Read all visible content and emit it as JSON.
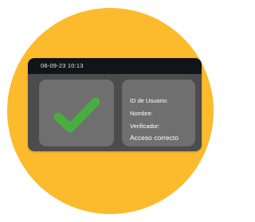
{
  "device": {
    "datetime": "08-09-23  10:13",
    "result_icon": "checkmark-icon",
    "info": {
      "user_id_label": "ID de Usuario:",
      "name_label": "Nombre:",
      "verifier_label": "Verificador:",
      "status": "Acceso correcto"
    }
  },
  "colors": {
    "backdrop": "#fcbb2c",
    "device_body": "#4b4c4b",
    "status_bar": "#111418",
    "panel": "#6e6f6e",
    "check": "#49ae3f",
    "text": "#ffffff"
  }
}
